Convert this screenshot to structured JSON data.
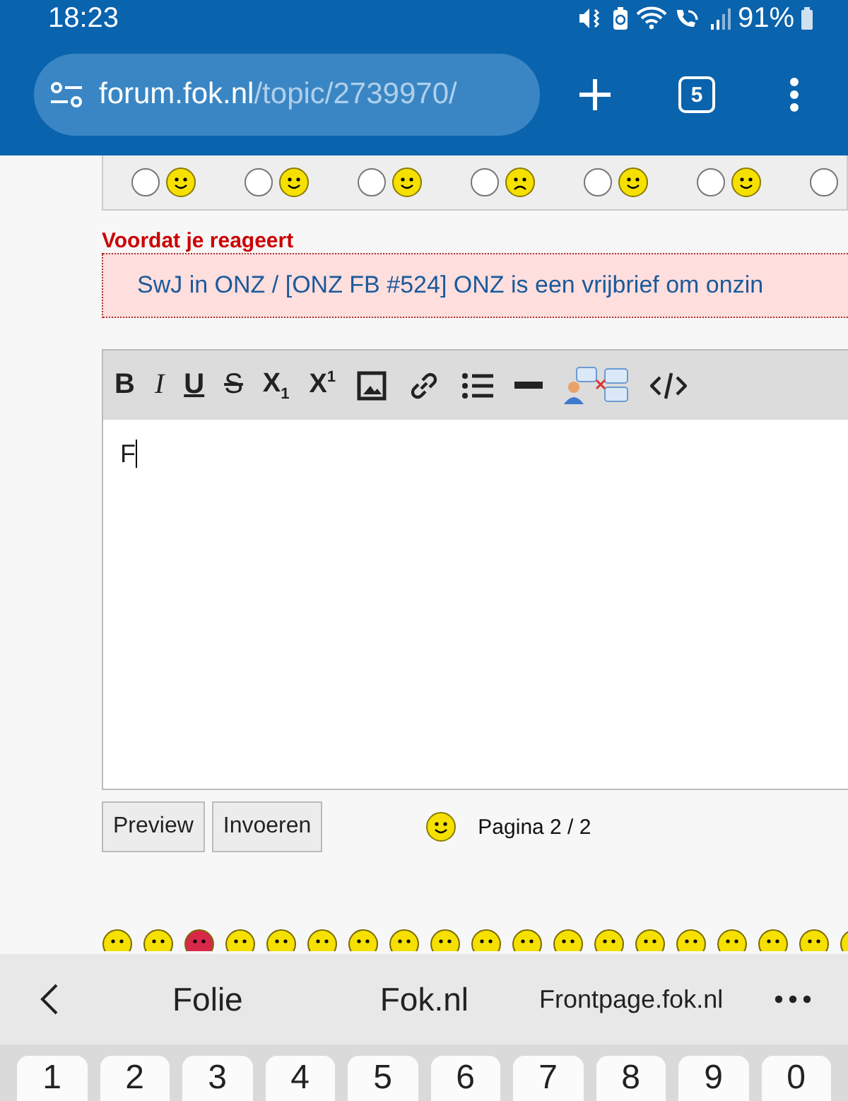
{
  "status_bar": {
    "time": "18:23",
    "battery": "91%"
  },
  "address_bar": {
    "host": "forum.fok.nl",
    "path": "/topic/2739970/",
    "tab_count": "5"
  },
  "mood_radios": [
    {
      "selected": false
    },
    {
      "selected": false
    },
    {
      "selected": false
    },
    {
      "selected": false
    },
    {
      "selected": false
    },
    {
      "selected": false
    },
    {
      "selected": false
    }
  ],
  "notice": {
    "heading": "Voordat je reageert",
    "link": "SwJ in ONZ / [ONZ FB #524] ONZ is een vrijbrief om onzin"
  },
  "toolbar": [
    {
      "kind": "bold",
      "label": "B"
    },
    {
      "kind": "italic",
      "label": "I"
    },
    {
      "kind": "underline",
      "label": "U"
    },
    {
      "kind": "strike",
      "label": "S"
    },
    {
      "kind": "script",
      "label": "X$_{1}$"
    },
    {
      "kind": "script",
      "label": "X$^{1}$"
    },
    {
      "kind": "image"
    },
    {
      "kind": "link"
    },
    {
      "kind": "list"
    },
    {
      "kind": "rule"
    },
    {
      "kind": "quote"
    },
    {
      "kind": "code"
    }
  ],
  "editor": {
    "value": "F"
  },
  "buttons": [
    "Preview",
    "Invoeren"
  ],
  "pagination": "Pagina 2 / 2",
  "suggestions": [
    "Folie",
    "Fok.nl",
    "Frontpage.fok.nl"
  ],
  "keys": [
    "1",
    "2",
    "3",
    "4",
    "5",
    "6",
    "7",
    "8",
    "9",
    "0"
  ]
}
